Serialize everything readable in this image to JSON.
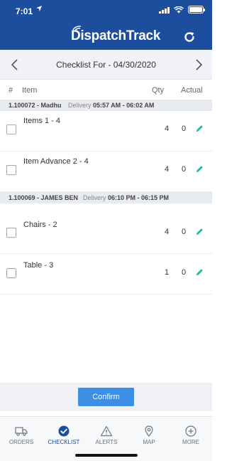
{
  "status_bar": {
    "time": "7:01",
    "location_arrow": "location-arrow-icon"
  },
  "header": {
    "logo_text": "DispatchTrack",
    "refresh_icon": "refresh-icon"
  },
  "date_bar": {
    "title": "Checklist For - 04/30/2020",
    "prev_icon": "chevron-left-icon",
    "next_icon": "chevron-right-icon"
  },
  "columns": {
    "num": "#",
    "item": "Item",
    "qty": "Qty",
    "actual": "Actual"
  },
  "groups": [
    {
      "id": "1.100072 - Madhu",
      "type": "Delivery",
      "time": "05:57 AM - 06:02 AM",
      "items": [
        {
          "name": "Items 1 - 4",
          "qty": "4",
          "actual": "0"
        },
        {
          "name": "Item Advance 2 - 4",
          "qty": "4",
          "actual": "0"
        }
      ]
    },
    {
      "id": "1.100069 - JAMES BEN",
      "type": "Delivery",
      "time": "06:10 PM - 06:15 PM",
      "items": [
        {
          "name": "Chairs - 2",
          "qty": "4",
          "actual": "0"
        },
        {
          "name": "Table - 3",
          "qty": "1",
          "actual": "0"
        }
      ]
    }
  ],
  "confirm_label": "Confirm",
  "tabs": [
    {
      "label": "ORDERS",
      "icon": "truck-icon",
      "active": false
    },
    {
      "label": "CHECKLIST",
      "icon": "check-circle-icon",
      "active": true
    },
    {
      "label": "ALERTS",
      "icon": "alert-triangle-icon",
      "active": false
    },
    {
      "label": "MAP",
      "icon": "map-pin-icon",
      "active": false
    },
    {
      "label": "MORE",
      "icon": "plus-circle-icon",
      "active": false
    }
  ],
  "colors": {
    "brand_blue": "#1d4e9e",
    "confirm_blue": "#3d8fe6",
    "edit_teal": "#1fb8a5"
  }
}
